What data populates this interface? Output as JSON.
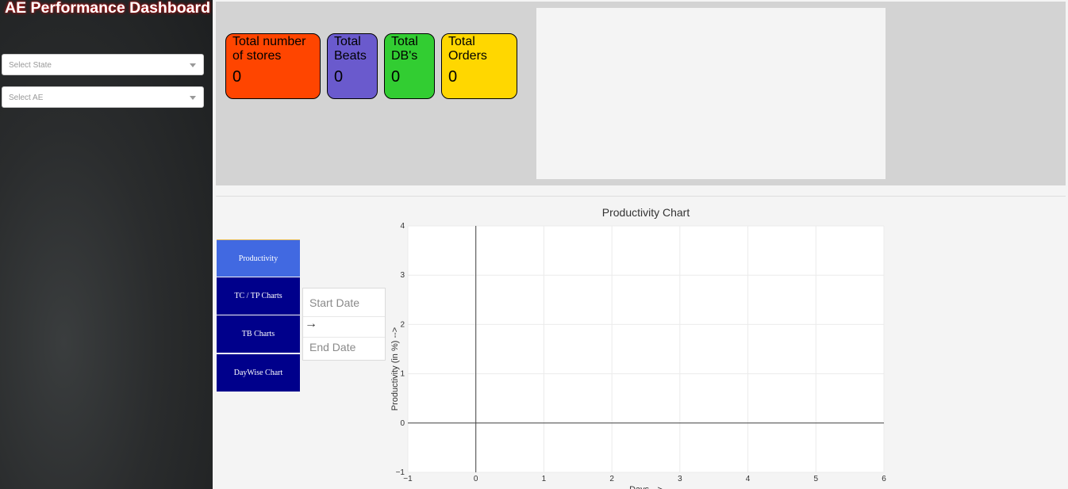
{
  "sidebar": {
    "title": "AE Performance Dashboard",
    "state_select": {
      "placeholder": "Select State"
    },
    "ae_select": {
      "placeholder": "Select AE"
    }
  },
  "cards": [
    {
      "label_line1": "Total number",
      "label_line2": "of stores",
      "value": "0",
      "color": "#ff4500"
    },
    {
      "label_line1": "Total",
      "label_line2": "Beats",
      "value": "0",
      "color": "#6a5acd"
    },
    {
      "label_line1": "Total",
      "label_line2": "DB's",
      "value": "0",
      "color": "#32cd32"
    },
    {
      "label_line1": "Total",
      "label_line2": "Orders",
      "value": "0",
      "color": "#ffd700"
    }
  ],
  "tabs": [
    {
      "label": "Productivity",
      "active": true
    },
    {
      "label": "TC / TP Charts",
      "active": false
    },
    {
      "label": "TB Charts",
      "active": false
    },
    {
      "label": "DayWise Chart",
      "active": false
    }
  ],
  "colors": {
    "tab_active": "#4169e1",
    "tab_inactive": "#00008b"
  },
  "date_range": {
    "start_placeholder": "Start Date",
    "arrow": "→",
    "end_placeholder": "End Date"
  },
  "chart_data": {
    "type": "line",
    "title": "Productivity Chart",
    "xlabel": "Days -->",
    "ylabel": "Productivity (in %) -->",
    "xlim": [
      -1,
      6
    ],
    "ylim": [
      -1,
      4
    ],
    "x_ticks": [
      -1,
      0,
      1,
      2,
      3,
      4,
      5,
      6
    ],
    "y_ticks": [
      -1,
      0,
      1,
      2,
      3,
      4
    ],
    "grid": true,
    "series": []
  }
}
